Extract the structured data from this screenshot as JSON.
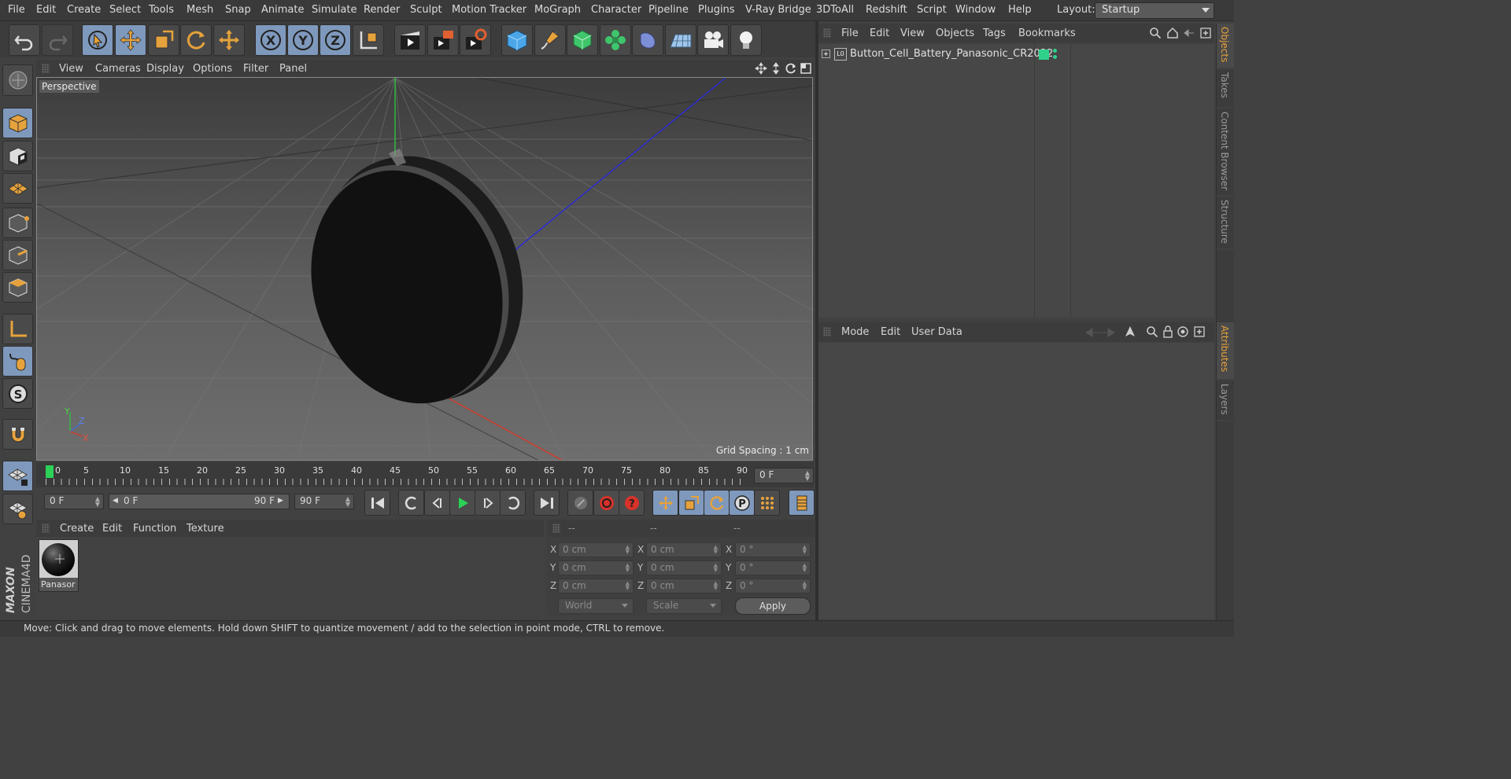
{
  "menubar": {
    "items": [
      "File",
      "Edit",
      "Create",
      "Select",
      "Tools",
      "Mesh",
      "Snap",
      "Animate",
      "Simulate",
      "Render",
      "Sculpt",
      "Motion Tracker",
      "MoGraph",
      "Character",
      "Pipeline",
      "Plugins",
      "V-Ray Bridge",
      "3DToAll",
      "Redshift",
      "Script",
      "Window",
      "Help"
    ],
    "layout_label": "Layout:",
    "layout_value": "Startup"
  },
  "toolbar": {
    "icons": [
      "undo-icon",
      "redo-icon",
      "live-selection-icon",
      "move-icon",
      "scale-icon",
      "rotate-icon",
      "recent-tool-icon",
      "x-axis-icon",
      "y-axis-icon",
      "z-axis-icon",
      "coordinate-system-icon",
      "render-view-icon",
      "render-picture-viewer-icon",
      "render-settings-icon",
      "cube-icon",
      "pen-spline-icon",
      "subdivision-icon",
      "cloner-icon",
      "deformer-icon",
      "floor-icon",
      "camera-icon",
      "light-icon"
    ],
    "axis_x": "X",
    "axis_y": "Y",
    "axis_z": "Z"
  },
  "viewport": {
    "menu": [
      "View",
      "Cameras",
      "Display",
      "Options",
      "Filter",
      "Panel"
    ],
    "camera_label": "Perspective",
    "grid_spacing": "Grid Spacing : 1 cm",
    "axis_labels": {
      "y": "Y",
      "z": "Z",
      "x": "X"
    }
  },
  "timeline": {
    "ticks": [
      "0",
      "5",
      "10",
      "15",
      "20",
      "25",
      "30",
      "35",
      "40",
      "45",
      "50",
      "55",
      "60",
      "65",
      "70",
      "75",
      "80",
      "85",
      "90"
    ],
    "current_frame": "0 F",
    "start_frame": "0 F",
    "range_start": "0 F",
    "range_end": "90 F",
    "end_frame": "90 F"
  },
  "material_manager": {
    "menu": [
      "Create",
      "Edit",
      "Function",
      "Texture"
    ],
    "materials": [
      {
        "name": "Panasor"
      }
    ]
  },
  "coordinates": {
    "headers": [
      "--",
      "--",
      "--"
    ],
    "rows": [
      {
        "axis": "X",
        "pos": "0 cm",
        "size": "0 cm",
        "rot": "0 °"
      },
      {
        "axis": "Y",
        "pos": "0 cm",
        "size": "0 cm",
        "rot": "0 °"
      },
      {
        "axis": "Z",
        "pos": "0 cm",
        "size": "0 cm",
        "rot": "0 °"
      }
    ],
    "rot_labels": [
      "X",
      "Y",
      "Z"
    ],
    "coord_mode": "World",
    "size_mode": "Scale",
    "apply_label": "Apply"
  },
  "objects_panel": {
    "menu": [
      "File",
      "Edit",
      "View",
      "Objects",
      "Tags",
      "Bookmarks"
    ],
    "items": [
      {
        "name": "Button_Cell_Battery_Panasonic_CR2032",
        "layer_badge": "L0",
        "layer_color": "#2fd18b"
      }
    ]
  },
  "attributes_panel": {
    "menu": [
      "Mode",
      "Edit",
      "User Data"
    ]
  },
  "side_tabs": {
    "top": [
      "Objects",
      "Takes",
      "Content Browser",
      "Structure"
    ],
    "bottom": [
      "Attributes",
      "Layers"
    ]
  },
  "brand": {
    "maxon": "MAXON",
    "product": "CINEMA4D"
  },
  "status_text": "Move: Click and drag to move elements. Hold down SHIFT to quantize movement / add to the selection in point mode, CTRL to remove.",
  "colors": {
    "accent": "#e6a23c",
    "selected_tool": "#7f99bd",
    "play_green": "#2bd156",
    "layer_green": "#2fd18b"
  }
}
